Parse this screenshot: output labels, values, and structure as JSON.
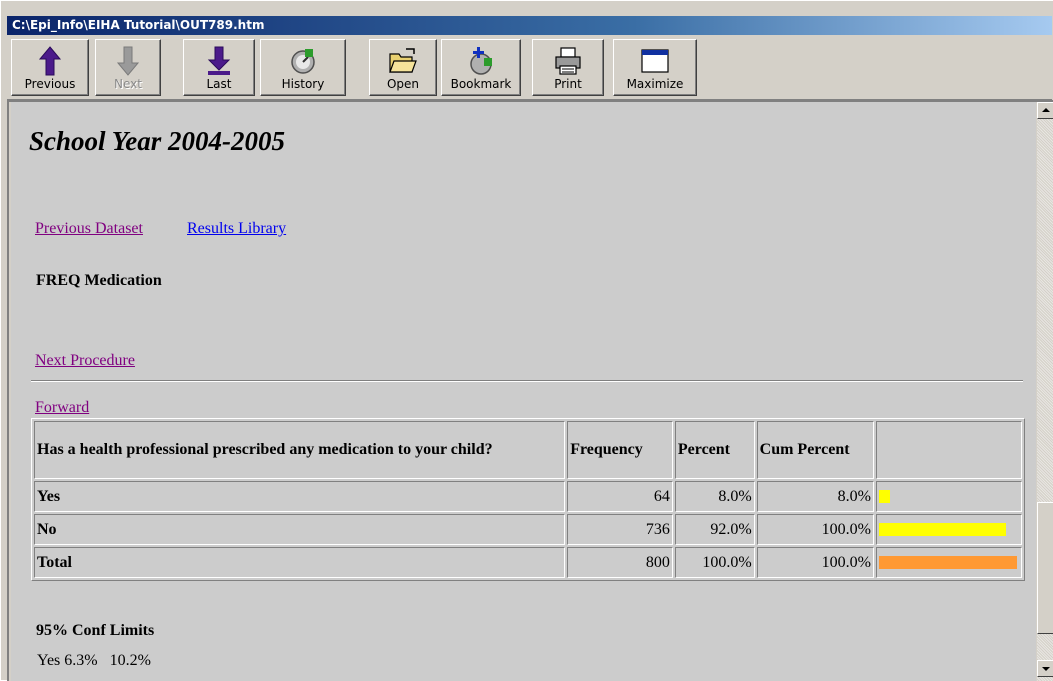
{
  "window": {
    "title": "C:\\Epi_Info\\EIHA Tutorial\\OUT789.htm"
  },
  "toolbar": {
    "buttons": [
      {
        "label": "Previous",
        "icon": "up-arrow-icon",
        "enabled": true
      },
      {
        "label": "Next",
        "icon": "down-arrow-icon",
        "enabled": false
      },
      {
        "label": "Last",
        "icon": "last-arrow-icon",
        "enabled": true
      },
      {
        "label": "History",
        "icon": "history-icon",
        "enabled": true
      },
      {
        "label": "Open",
        "icon": "open-folder-icon",
        "enabled": true
      },
      {
        "label": "Bookmark",
        "icon": "bookmark-icon",
        "enabled": true
      },
      {
        "label": "Print",
        "icon": "printer-icon",
        "enabled": true
      },
      {
        "label": "Maximize",
        "icon": "maximize-icon",
        "enabled": true
      }
    ]
  },
  "page": {
    "title": "School Year 2004-2005",
    "links": {
      "previous_dataset": "Previous Dataset",
      "results_library": "Results Library",
      "next_procedure": "Next Procedure",
      "forward": "Forward"
    },
    "procedure_heading": "FREQ Medication",
    "table": {
      "headers": {
        "question": "Has a health professional prescribed any medication to your child?",
        "frequency": "Frequency",
        "percent": "Percent",
        "cum_percent": "Cum Percent"
      },
      "rows": [
        {
          "label": "Yes",
          "frequency": "64",
          "percent": "8.0%",
          "cum_percent": "8.0%",
          "bar_fraction": 0.08,
          "bar_color": "#ffff00"
        },
        {
          "label": "No",
          "frequency": "736",
          "percent": "92.0%",
          "cum_percent": "100.0%",
          "bar_fraction": 0.92,
          "bar_color": "#ffff00"
        },
        {
          "label": "Total",
          "frequency": "800",
          "percent": "100.0%",
          "cum_percent": "100.0%",
          "bar_fraction": 1.0,
          "bar_color": "#ff9933"
        }
      ]
    },
    "conf_heading": "95% Conf Limits",
    "conf_line": "Yes 6.3%   10.2%"
  }
}
